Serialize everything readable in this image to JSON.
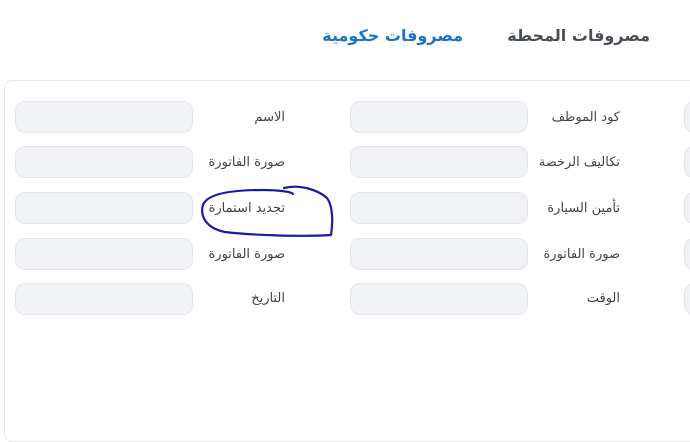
{
  "tabs": [
    {
      "label": "مصروفات المحطة"
    },
    {
      "label": "مصروفات حكومية"
    }
  ],
  "form": {
    "rows": [
      {
        "mid_label": "كود الموظف",
        "left_label": "الاسم"
      },
      {
        "mid_label": "تكاليف الرخصة",
        "left_label": "صورة الفاتورة"
      },
      {
        "mid_label": "تأمين السيارة",
        "left_label": "تجديد استمارة"
      },
      {
        "mid_label": "صورة الفاتورة",
        "left_label": "صورة الفاتورة"
      },
      {
        "mid_label": "الوقت",
        "left_label": "التاريخ"
      }
    ]
  },
  "colors": {
    "active_tab": "#1a73c9",
    "annotation": "#1a1aa8"
  }
}
